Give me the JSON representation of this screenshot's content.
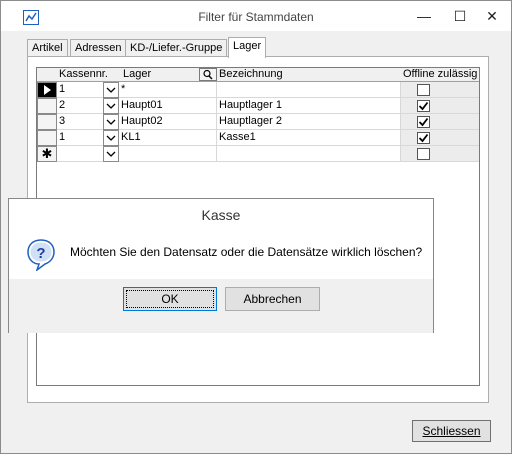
{
  "window": {
    "title": "Filter für Stammdaten",
    "controls": [
      "—",
      "☐",
      "✕"
    ]
  },
  "tabs": [
    {
      "label": "Artikel",
      "active": false
    },
    {
      "label": "Adressen",
      "active": false
    },
    {
      "label": "KD-/Liefer.-Gruppe",
      "active": false
    },
    {
      "label": "Lager",
      "active": true
    }
  ],
  "grid": {
    "columns": [
      "Kassennr.",
      "Lager",
      "Bezeichnung",
      "Offline zulässig"
    ],
    "rows": [
      {
        "kassennr": "1",
        "lager": "*",
        "bezeichnung": "",
        "offline": false,
        "current": true
      },
      {
        "kassennr": "2",
        "lager": "Haupt01",
        "bezeichnung": "Hauptlager 1",
        "offline": true,
        "current": false
      },
      {
        "kassennr": "3",
        "lager": "Haupt02",
        "bezeichnung": "Hauptlager 2",
        "offline": true,
        "current": false
      },
      {
        "kassennr": "1",
        "lager": "KL1",
        "bezeichnung": "Kasse1",
        "offline": true,
        "current": false
      }
    ],
    "new_row_marker": "✱"
  },
  "close_button": "Schliessen",
  "dialog": {
    "title": "Kasse",
    "message": "Möchten Sie den Datensatz oder die Datensätze wirklich löschen?",
    "ok": "OK",
    "cancel": "Abbrechen"
  },
  "colors": {
    "accent": "#0078d7",
    "icon_blue": "#1f5fbf"
  }
}
